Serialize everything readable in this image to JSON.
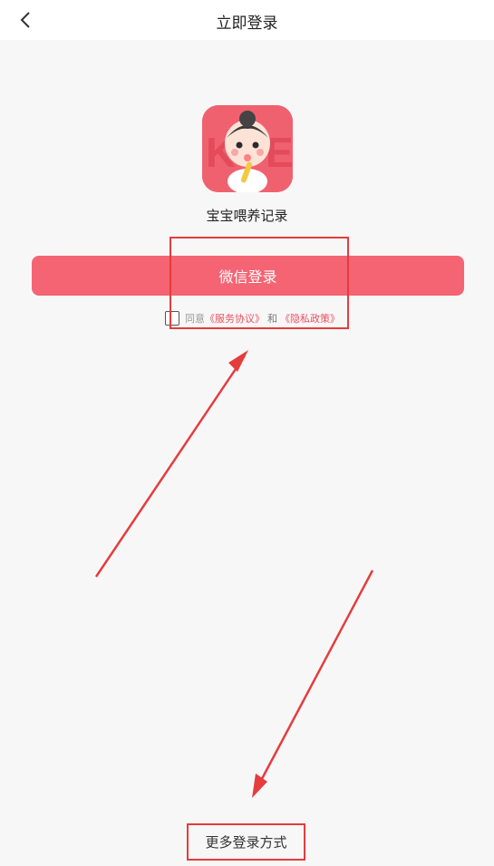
{
  "header": {
    "title": "立即登录"
  },
  "app": {
    "name": "宝宝喂养记录"
  },
  "login": {
    "wechat_label": "微信登录"
  },
  "agreement": {
    "prefix": "同意",
    "service_link": "《服务协议》",
    "and": "和",
    "privacy_link": "《隐私政策》"
  },
  "footer": {
    "more_methods": "更多登录方式"
  },
  "colors": {
    "accent": "#f46473",
    "annotation": "#e53c3c",
    "link": "#e8525f"
  }
}
